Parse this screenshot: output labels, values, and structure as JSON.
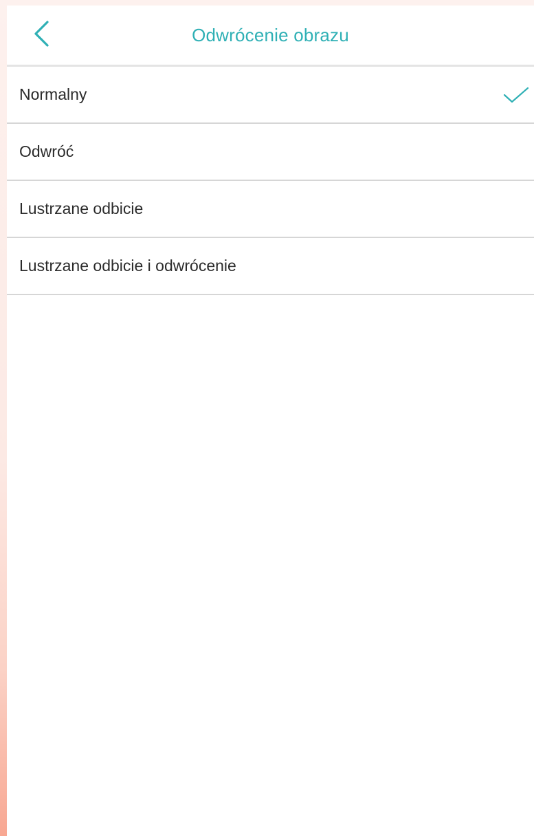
{
  "header": {
    "title": "Odwrócenie obrazu",
    "back_icon": "chevron-left-icon"
  },
  "options": [
    {
      "label": "Normalny",
      "selected": true
    },
    {
      "label": "Odwróć",
      "selected": false
    },
    {
      "label": "Lustrzane odbicie",
      "selected": false
    },
    {
      "label": "Lustrzane odbicie i odwrócenie",
      "selected": false
    }
  ],
  "selected_icon": "checkmark-icon",
  "colors": {
    "accent": "#2fb0b5",
    "text": "#2b2b2b",
    "divider": "#d6d6d6"
  }
}
